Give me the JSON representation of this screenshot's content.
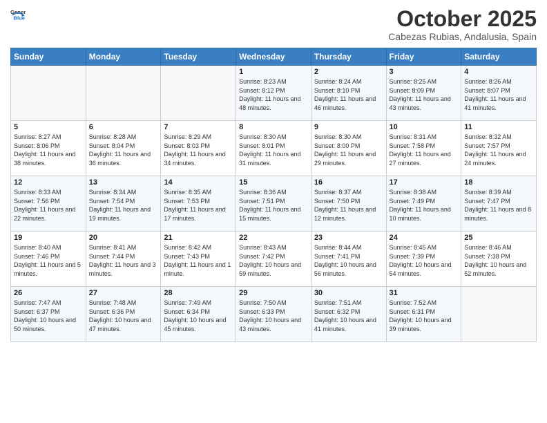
{
  "header": {
    "title": "October 2025",
    "location": "Cabezas Rubias, Andalusia, Spain"
  },
  "calendar": {
    "days": [
      "Sunday",
      "Monday",
      "Tuesday",
      "Wednesday",
      "Thursday",
      "Friday",
      "Saturday"
    ]
  },
  "weeks": [
    [
      null,
      null,
      null,
      {
        "day": 1,
        "sunrise": "8:23 AM",
        "sunset": "8:12 PM",
        "daylight": "11 hours and 48 minutes."
      },
      {
        "day": 2,
        "sunrise": "8:24 AM",
        "sunset": "8:10 PM",
        "daylight": "11 hours and 46 minutes."
      },
      {
        "day": 3,
        "sunrise": "8:25 AM",
        "sunset": "8:09 PM",
        "daylight": "11 hours and 43 minutes."
      },
      {
        "day": 4,
        "sunrise": "8:26 AM",
        "sunset": "8:07 PM",
        "daylight": "11 hours and 41 minutes."
      }
    ],
    [
      {
        "day": 5,
        "sunrise": "8:27 AM",
        "sunset": "8:06 PM",
        "daylight": "11 hours and 38 minutes."
      },
      {
        "day": 6,
        "sunrise": "8:28 AM",
        "sunset": "8:04 PM",
        "daylight": "11 hours and 36 minutes."
      },
      {
        "day": 7,
        "sunrise": "8:29 AM",
        "sunset": "8:03 PM",
        "daylight": "11 hours and 34 minutes."
      },
      {
        "day": 8,
        "sunrise": "8:30 AM",
        "sunset": "8:01 PM",
        "daylight": "11 hours and 31 minutes."
      },
      {
        "day": 9,
        "sunrise": "8:30 AM",
        "sunset": "8:00 PM",
        "daylight": "11 hours and 29 minutes."
      },
      {
        "day": 10,
        "sunrise": "8:31 AM",
        "sunset": "7:58 PM",
        "daylight": "11 hours and 27 minutes."
      },
      {
        "day": 11,
        "sunrise": "8:32 AM",
        "sunset": "7:57 PM",
        "daylight": "11 hours and 24 minutes."
      }
    ],
    [
      {
        "day": 12,
        "sunrise": "8:33 AM",
        "sunset": "7:56 PM",
        "daylight": "11 hours and 22 minutes."
      },
      {
        "day": 13,
        "sunrise": "8:34 AM",
        "sunset": "7:54 PM",
        "daylight": "11 hours and 19 minutes."
      },
      {
        "day": 14,
        "sunrise": "8:35 AM",
        "sunset": "7:53 PM",
        "daylight": "11 hours and 17 minutes."
      },
      {
        "day": 15,
        "sunrise": "8:36 AM",
        "sunset": "7:51 PM",
        "daylight": "11 hours and 15 minutes."
      },
      {
        "day": 16,
        "sunrise": "8:37 AM",
        "sunset": "7:50 PM",
        "daylight": "11 hours and 12 minutes."
      },
      {
        "day": 17,
        "sunrise": "8:38 AM",
        "sunset": "7:49 PM",
        "daylight": "11 hours and 10 minutes."
      },
      {
        "day": 18,
        "sunrise": "8:39 AM",
        "sunset": "7:47 PM",
        "daylight": "11 hours and 8 minutes."
      }
    ],
    [
      {
        "day": 19,
        "sunrise": "8:40 AM",
        "sunset": "7:46 PM",
        "daylight": "11 hours and 5 minutes."
      },
      {
        "day": 20,
        "sunrise": "8:41 AM",
        "sunset": "7:44 PM",
        "daylight": "11 hours and 3 minutes."
      },
      {
        "day": 21,
        "sunrise": "8:42 AM",
        "sunset": "7:43 PM",
        "daylight": "11 hours and 1 minute."
      },
      {
        "day": 22,
        "sunrise": "8:43 AM",
        "sunset": "7:42 PM",
        "daylight": "10 hours and 59 minutes."
      },
      {
        "day": 23,
        "sunrise": "8:44 AM",
        "sunset": "7:41 PM",
        "daylight": "10 hours and 56 minutes."
      },
      {
        "day": 24,
        "sunrise": "8:45 AM",
        "sunset": "7:39 PM",
        "daylight": "10 hours and 54 minutes."
      },
      {
        "day": 25,
        "sunrise": "8:46 AM",
        "sunset": "7:38 PM",
        "daylight": "10 hours and 52 minutes."
      }
    ],
    [
      {
        "day": 26,
        "sunrise": "7:47 AM",
        "sunset": "6:37 PM",
        "daylight": "10 hours and 50 minutes."
      },
      {
        "day": 27,
        "sunrise": "7:48 AM",
        "sunset": "6:36 PM",
        "daylight": "10 hours and 47 minutes."
      },
      {
        "day": 28,
        "sunrise": "7:49 AM",
        "sunset": "6:34 PM",
        "daylight": "10 hours and 45 minutes."
      },
      {
        "day": 29,
        "sunrise": "7:50 AM",
        "sunset": "6:33 PM",
        "daylight": "10 hours and 43 minutes."
      },
      {
        "day": 30,
        "sunrise": "7:51 AM",
        "sunset": "6:32 PM",
        "daylight": "10 hours and 41 minutes."
      },
      {
        "day": 31,
        "sunrise": "7:52 AM",
        "sunset": "6:31 PM",
        "daylight": "10 hours and 39 minutes."
      },
      null
    ]
  ]
}
